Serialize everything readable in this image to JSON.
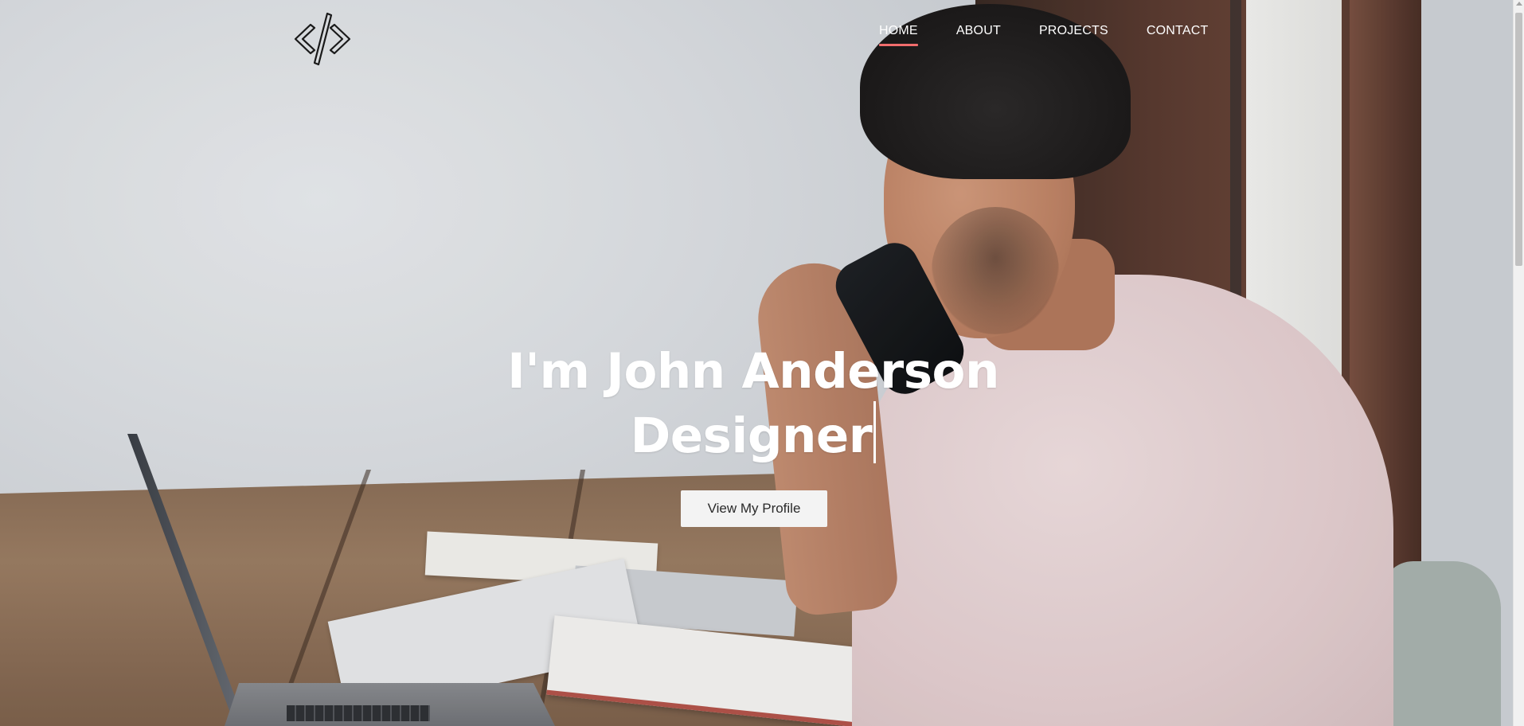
{
  "nav": {
    "items": [
      {
        "label": "HOME",
        "active": true
      },
      {
        "label": "ABOUT",
        "active": false
      },
      {
        "label": "PROJECTS",
        "active": false
      },
      {
        "label": "CONTACT",
        "active": false
      }
    ],
    "active_underline_color": "#f26d6d"
  },
  "logo": {
    "icon": "code-brackets-icon"
  },
  "hero": {
    "line1": "I'm John Anderson",
    "line2": "Designer",
    "cta_label": "View My Profile"
  },
  "colors": {
    "text_on_image": "#ffffff",
    "button_bg": "#f3f3f3",
    "button_text": "#2a2a2a"
  }
}
